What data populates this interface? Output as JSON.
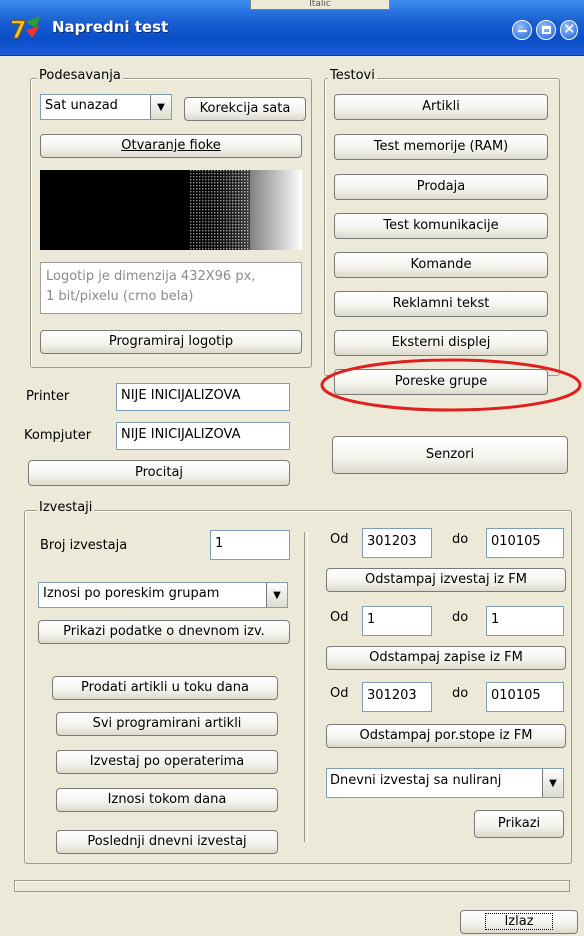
{
  "window": {
    "title": "Napredni test",
    "top_tab": "Italic"
  },
  "podesavanja": {
    "legend": "Podesavanja",
    "combo_value": "Sat unazad",
    "korekcija_label": "Korekcija sata",
    "otvaranje_label": "Otvaranje fioke",
    "logo_info_line1": "Logotip je dimenzija 432X96 px,",
    "logo_info_line2": "1 bit/pixelu (crno bela)",
    "programiraj_label": "Programiraj logotip"
  },
  "printer": {
    "label": "Printer",
    "value": "NIJE INICIJALIZOVA"
  },
  "kompjuter": {
    "label": "Kompjuter",
    "value": "NIJE INICIJALIZOVA"
  },
  "procitaj_label": "Procitaj",
  "testovi": {
    "legend": "Testovi",
    "buttons": [
      "Artikli",
      "Test memorije (RAM)",
      "Prodaja",
      "Test komunikacije",
      "Komande",
      "Reklamni tekst",
      "Eksterni displej",
      "Poreske grupe"
    ]
  },
  "senzori_label": "Senzori",
  "izvestaji": {
    "legend": "Izvestaji",
    "broj_label": "Broj izvestaja",
    "broj_value": "1",
    "combo_value": "Iznosi po poreskim grupam",
    "prikazi_dnevni": "Prikazi podatke o dnevnom izv.",
    "left_buttons": [
      "Prodati artikli u toku dana",
      "Svi programirani artikli",
      "Izvestaj po operaterima",
      "Iznosi tokom dana",
      "Poslednji dnevni izvestaj"
    ],
    "od_label": "Od",
    "do_label": "do",
    "range1": {
      "od": "301203",
      "do": "010105"
    },
    "btn1": "Odstampaj izvestaj iz FM",
    "range2": {
      "od": "1",
      "do": "1"
    },
    "btn2": "Odstampaj zapise iz FM",
    "range3": {
      "od": "301203",
      "do": "010105"
    },
    "btn3": "Odstampaj por.stope iz FM",
    "combo2_value": "Dnevni izvestaj sa nuliranj",
    "prikazi_label": "Prikazi"
  },
  "izlaz_label": "Izlaz",
  "colors": {
    "highlight_ring": "#e0201e",
    "title_bar": "#1a5fd0"
  }
}
